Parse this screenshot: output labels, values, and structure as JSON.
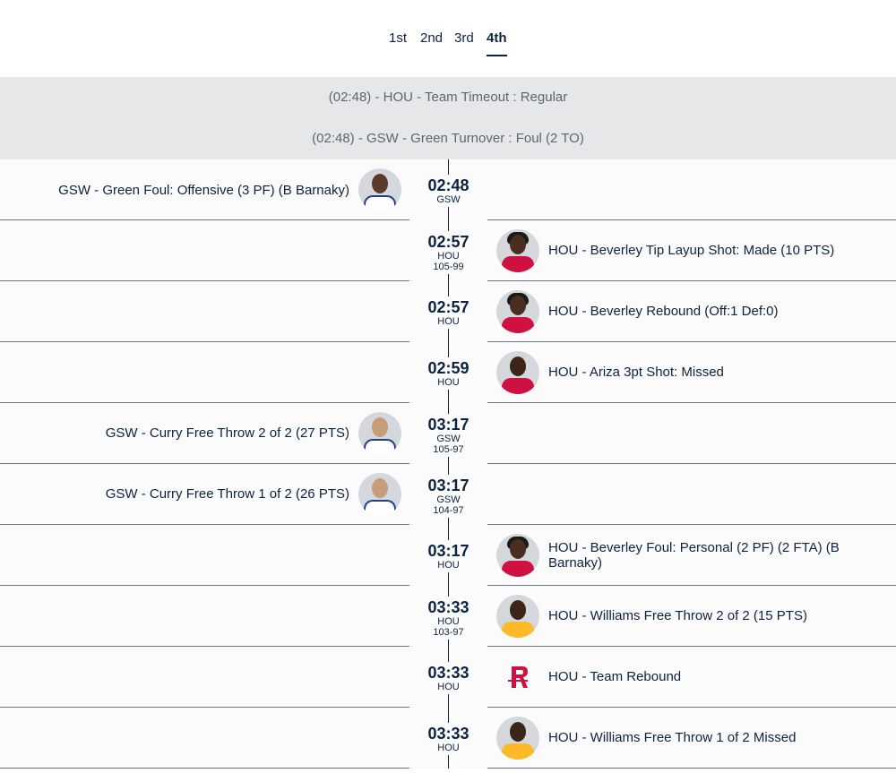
{
  "periods": [
    {
      "label": "1st",
      "active": false
    },
    {
      "label": "2nd",
      "active": false
    },
    {
      "label": "3rd",
      "active": false
    },
    {
      "label": "4th",
      "active": true
    }
  ],
  "neutral_events": [
    "(02:48) - HOU - Team Timeout : Regular",
    "(02:48) - GSW - Green Turnover : Foul (2 TO)"
  ],
  "plays": [
    {
      "time": "02:48",
      "team": "GSW",
      "score": "",
      "side": "left",
      "player": "green-avatar",
      "description": "GSW - Green Foul: Offensive (3 PF) (B Barnaky)"
    },
    {
      "time": "02:57",
      "team": "HOU",
      "score": "105-99",
      "side": "right",
      "player": "beverley-avatar",
      "description": "HOU - Beverley Tip Layup Shot: Made (10 PTS)"
    },
    {
      "time": "02:57",
      "team": "HOU",
      "score": "",
      "side": "right",
      "player": "beverley-avatar",
      "description": "HOU - Beverley Rebound (Off:1 Def:0)"
    },
    {
      "time": "02:59",
      "team": "HOU",
      "score": "",
      "side": "right",
      "player": "ariza-avatar",
      "description": "HOU - Ariza 3pt Shot: Missed"
    },
    {
      "time": "03:17",
      "team": "GSW",
      "score": "105-97",
      "side": "left",
      "player": "curry-avatar",
      "description": "GSW - Curry Free Throw 2 of 2 (27 PTS)"
    },
    {
      "time": "03:17",
      "team": "GSW",
      "score": "104-97",
      "side": "left",
      "player": "curry-avatar",
      "description": "GSW - Curry Free Throw 1 of 2 (26 PTS)"
    },
    {
      "time": "03:17",
      "team": "HOU",
      "score": "",
      "side": "right",
      "player": "beverley-avatar",
      "description": "HOU - Beverley Foul: Personal (2 PF) (2 FTA) (B Barnaky)"
    },
    {
      "time": "03:33",
      "team": "HOU",
      "score": "103-97",
      "side": "right",
      "player": "williams-avatar",
      "description": "HOU - Williams Free Throw 2 of 2 (15 PTS)"
    },
    {
      "time": "03:33",
      "team": "HOU",
      "score": "",
      "side": "right",
      "player": "rockets-logo-icon",
      "description": "HOU - Team Rebound"
    },
    {
      "time": "03:33",
      "team": "HOU",
      "score": "",
      "side": "right",
      "player": "williams-avatar",
      "description": "HOU - Williams Free Throw 1 of 2 Missed"
    }
  ],
  "colors": {
    "navy": "#0c2340",
    "neutral_bg": "#e6e7e9",
    "gsw_uniform": "#ffffff",
    "gsw_trim": "#1d428a",
    "hou_uniform": "#ce1141",
    "lakers_uniform": "#fdb927"
  }
}
